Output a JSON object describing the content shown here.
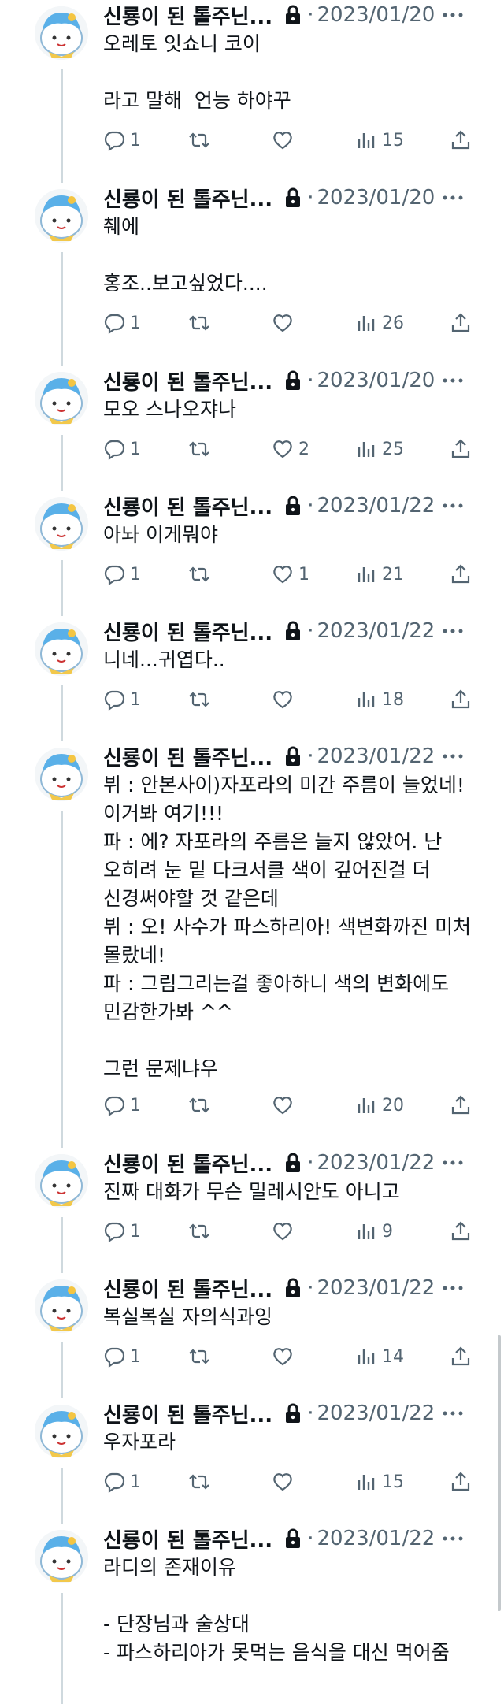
{
  "colors": {
    "text": "#0f1419",
    "muted": "#536471",
    "thread_line": "#cfd9de"
  },
  "tweets": [
    {
      "name": "신룡이 된 톨주닌...",
      "dot": "·",
      "date": "2023/01/20",
      "text": "오레토 잇쇼니 코이\n\n라고 말해  언능 하야꾸",
      "replies": "1",
      "retweets": "",
      "likes": "",
      "views": "15"
    },
    {
      "name": "신룡이 된 톨주닌...",
      "dot": "·",
      "date": "2023/01/20",
      "text": "췌에\n\n홍조..보고싶었다....",
      "replies": "1",
      "retweets": "",
      "likes": "",
      "views": "26"
    },
    {
      "name": "신룡이 된 톨주닌...",
      "dot": "·",
      "date": "2023/01/20",
      "text": "모오 스나오쟈나",
      "replies": "1",
      "retweets": "",
      "likes": "2",
      "views": "25"
    },
    {
      "name": "신룡이 된 톨주닌...",
      "dot": "·",
      "date": "2023/01/22",
      "text": "아놔 이게뭐야",
      "replies": "1",
      "retweets": "",
      "likes": "1",
      "views": "21"
    },
    {
      "name": "신룡이 된 톨주닌...",
      "dot": "·",
      "date": "2023/01/22",
      "text": "니네...귀엽다..",
      "replies": "1",
      "retweets": "",
      "likes": "",
      "views": "18"
    },
    {
      "name": "신룡이 된 톨주닌...",
      "dot": "·",
      "date": "2023/01/22",
      "text": "뷔 : 안본사이)자포라의 미간 주름이 늘었네!이거봐 여기!!!\n파 : 에? 자포라의 주름은 늘지 않았어. 난 오히려 눈 밑 다크서클 색이 깊어진걸 더 신경써야할 것 같은데\n뷔 : 오! 사수가 파스하리아! 색변화까진 미처 몰랐네!\n파 : 그림그리는걸 좋아하니 색의 변화에도 민감한가봐 ^^\n\n그런 문제냐우",
      "replies": "1",
      "retweets": "",
      "likes": "",
      "views": "20"
    },
    {
      "name": "신룡이 된 톨주닌...",
      "dot": "·",
      "date": "2023/01/22",
      "text": "진짜 대화가 무슨 밀레시안도 아니고",
      "replies": "1",
      "retweets": "",
      "likes": "",
      "views": "9"
    },
    {
      "name": "신룡이 된 톨주닌...",
      "dot": "·",
      "date": "2023/01/22",
      "text": "복실복실 자의식과잉",
      "replies": "1",
      "retweets": "",
      "likes": "",
      "views": "14"
    },
    {
      "name": "신룡이 된 톨주닌...",
      "dot": "·",
      "date": "2023/01/22",
      "text": "우자포라",
      "replies": "1",
      "retweets": "",
      "likes": "",
      "views": "15"
    },
    {
      "name": "신룡이 된 톨주닌...",
      "dot": "·",
      "date": "2023/01/22",
      "text": "라디의 존재이유\n\n- 단장님과 술상대\n- 파스하리아가 못먹는 음식을 대신 먹어줌",
      "replies": "",
      "retweets": "",
      "likes": "",
      "views": ""
    }
  ]
}
